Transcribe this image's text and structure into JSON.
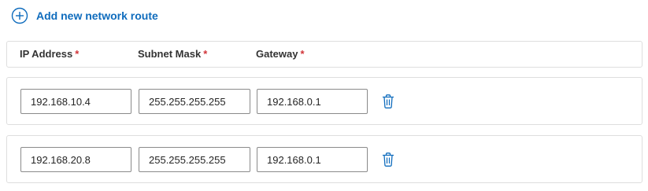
{
  "add_route": {
    "label": "Add new network route",
    "icon": "add-circle-icon"
  },
  "columns": [
    {
      "label": "IP Address",
      "required_marker": "*"
    },
    {
      "label": "Subnet Mask",
      "required_marker": "*"
    },
    {
      "label": "Gateway",
      "required_marker": "*"
    }
  ],
  "routes": [
    {
      "ip": "192.168.10.4",
      "mask": "255.255.255.255",
      "gateway": "192.168.0.1",
      "delete_icon": "trash-icon"
    },
    {
      "ip": "192.168.20.8",
      "mask": "255.255.255.255",
      "gateway": "192.168.0.1",
      "delete_icon": "trash-icon"
    }
  ],
  "colors": {
    "accent": "#0f6cbd",
    "required": "#d13438",
    "border": "#dedede",
    "field_border": "#8a8a8a"
  }
}
